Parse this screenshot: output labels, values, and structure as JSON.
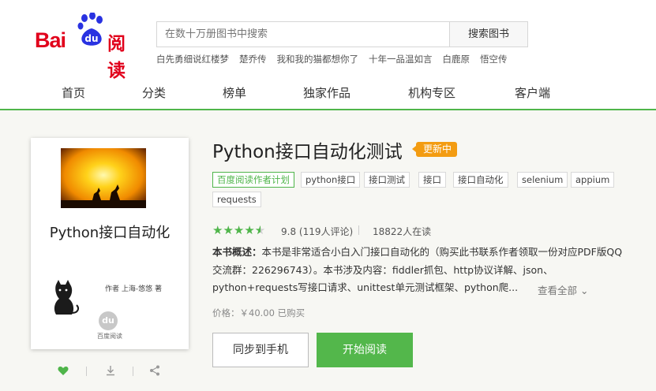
{
  "logo": {
    "bai": "Bai",
    "du": "du",
    "read": "阅读"
  },
  "search": {
    "placeholder": "在数十万册图书中搜索",
    "button": "搜索图书"
  },
  "hot_searches": [
    "白先勇细说红楼梦",
    "楚乔传",
    "我和我的猫都想你了",
    "十年一品温如言",
    "白鹿原",
    "悟空传"
  ],
  "nav": [
    "首页",
    "分类",
    "榜单",
    "独家作品",
    "机构专区",
    "客户端"
  ],
  "cover": {
    "title": "Python接口自动化",
    "author": "作者 上海-悠悠 著",
    "brand": "百度阅读",
    "du_mark": "du"
  },
  "book": {
    "title": "Python接口自动化测试",
    "badge": "更新中",
    "tags": [
      "百度阅读作者计划",
      "python接口",
      "接口测试",
      "接口",
      "接口自动化",
      "selenium",
      "appium",
      "requests"
    ],
    "rating_value": 4.5,
    "score_text": "9.8 (119人评论)",
    "readers": "18822人在读",
    "summary_label": "本书概述：",
    "summary_text": "本书是非常适合小白入门接口自动化的（购买此书联系作者领取一份对应PDF版QQ交流群：226296743）。本书涉及内容：fiddler抓包、http协议详解、json、python+requests写接口请求、unittest单元测试框架、python爬...",
    "more": "查看全部",
    "price": "价格：￥40.00  已购买",
    "sync_button": "同步到手机",
    "read_button": "开始阅读"
  },
  "colors": {
    "accent": "#4fb54a",
    "logo_red": "#e1001b",
    "logo_blue": "#2932e1",
    "badge": "#f39c12"
  }
}
